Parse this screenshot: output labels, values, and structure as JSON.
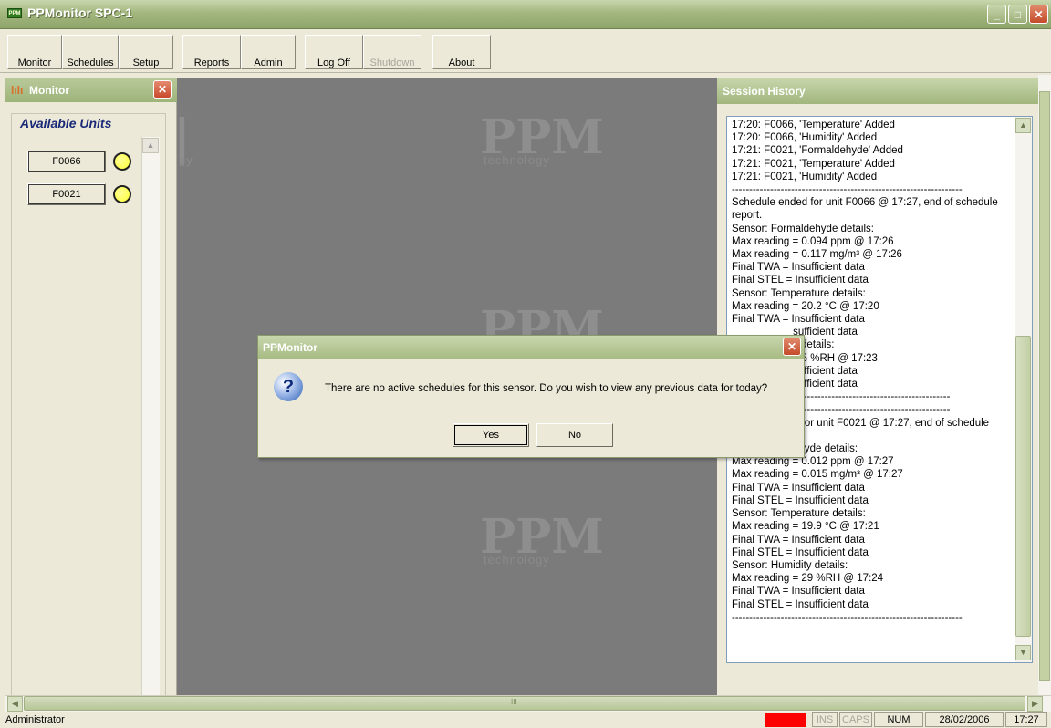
{
  "window": {
    "title": "PPMonitor SPC-1",
    "icon_name": "app-icon",
    "minimize": "_",
    "maximize": "□",
    "close": "✕"
  },
  "toolbar": {
    "monitor": "Monitor",
    "schedules": "Schedules",
    "setup": "Setup",
    "reports": "Reports",
    "admin": "Admin",
    "logoff": "Log Off",
    "shutdown": "Shutdown",
    "about": "About"
  },
  "monitor_panel": {
    "title": "Monitor",
    "close": "✕",
    "group_title": "Available Units",
    "scroll_up": "▲",
    "units": [
      {
        "label": "F0066",
        "status_color": "#ffff33"
      },
      {
        "label": "F0021",
        "status_color": "#ffff33"
      }
    ]
  },
  "watermark": {
    "logo": "PPM",
    "tagline": "technology"
  },
  "session_history": {
    "title": "Session History",
    "lines": [
      "17:20: F0066, 'Temperature' Added",
      "17:20: F0066, 'Humidity' Added",
      "17:21: F0021, 'Formaldehyde' Added",
      "17:21: F0021, 'Temperature' Added",
      "17:21: F0021, 'Humidity' Added",
      "------------------------------------------------------------------",
      "Schedule ended for unit F0066 @ 17:27, end of schedule",
      "report.",
      "Sensor: Formaldehyde details:",
      "Max reading = 0.094 ppm @ 17:26",
      "Max reading = 0.117 mg/m³ @ 17:26",
      "Final TWA = Insufficient data",
      "Final STEL = Insufficient data",
      "Sensor: Temperature details:",
      "Max reading = 20.2 °C @ 17:20",
      "Final TWA = Insufficient data",
      "                     sufficient data",
      "                     y details:",
      "                     8.5 %RH @ 17:23",
      "                     sufficient data",
      "                     sufficient data",
      "                     ---------------------------------------------",
      "                     ---------------------------------------------",
      "                     d for unit F0021 @ 17:27, end of schedule",
      "",
      "                     ehyde details:",
      "Max reading = 0.012 ppm @ 17:27",
      "Max reading = 0.015 mg/m³ @ 17:27",
      "Final TWA = Insufficient data",
      "Final STEL = Insufficient data",
      "Sensor: Temperature details:",
      "Max reading = 19.9 °C @ 17:21",
      "Final TWA = Insufficient data",
      "Final STEL = Insufficient data",
      "Sensor: Humidity details:",
      "Max reading = 29 %RH @ 17:24",
      "Final TWA = Insufficient data",
      "Final STEL = Insufficient data",
      "------------------------------------------------------------------"
    ],
    "scroll_up": "▲",
    "scroll_down": "▼"
  },
  "dialog": {
    "title": "PPMonitor",
    "close": "✕",
    "icon": "?",
    "message": "There are no active schedules for this sensor. Do you wish to view any previous data for today?",
    "yes": "Yes",
    "no": "No"
  },
  "hscroll": {
    "left": "◀",
    "right": "▶",
    "grip": "III"
  },
  "statusbar": {
    "user": "Administrator",
    "indicator_color": "#ff0000",
    "ins": "INS",
    "caps": "CAPS",
    "num": "NUM",
    "date": "28/02/2006",
    "time": "17:27"
  }
}
